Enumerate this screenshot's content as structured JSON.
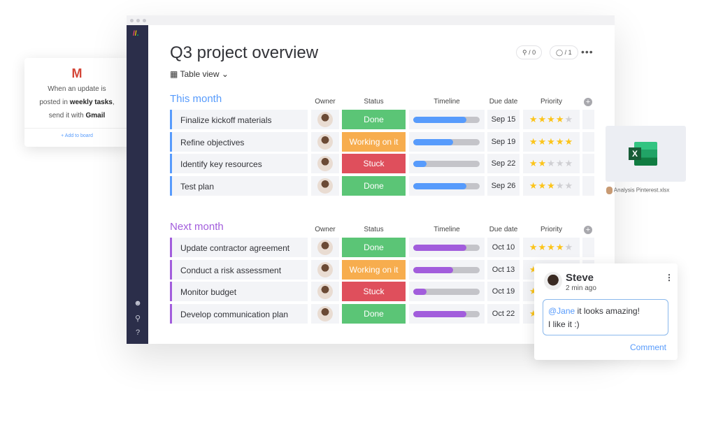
{
  "gmail_card": {
    "icon": "gmail-icon",
    "line1": "When an update is",
    "line2_pre": "posted in ",
    "line2_bold": "weekly tasks",
    "line2_post": ",",
    "line3_pre": "send it with ",
    "line3_bold": "Gmail",
    "add": "+ Add to board"
  },
  "board": {
    "title": "Q3 project overview",
    "view": "Table view",
    "activity_count": "/ 0",
    "integrations_count": "/ 1",
    "columns": {
      "owner": "Owner",
      "status": "Status",
      "timeline": "Timeline",
      "due": "Due date",
      "priority": "Priority"
    },
    "groups": [
      {
        "title": "This month",
        "color": "#579bfc",
        "items": [
          {
            "name": "Finalize kickoff materials",
            "status": "Done",
            "due": "Sep 15",
            "timeline_progress": 0.8,
            "priority": 4
          },
          {
            "name": "Refine objectives",
            "status": "Working on it",
            "due": "Sep 19",
            "timeline_progress": 0.6,
            "priority": 5
          },
          {
            "name": "Identify key resources",
            "status": "Stuck",
            "due": "Sep 22",
            "timeline_progress": 0.2,
            "priority": 2
          },
          {
            "name": "Test plan",
            "status": "Done",
            "due": "Sep 26",
            "timeline_progress": 0.8,
            "priority": 3
          }
        ]
      },
      {
        "title": "Next month",
        "color": "#a25ddc",
        "items": [
          {
            "name": "Update contractor agreement",
            "status": "Done",
            "due": "Oct 10",
            "timeline_progress": 0.8,
            "priority": 4
          },
          {
            "name": "Conduct a risk assessment",
            "status": "Working on it",
            "due": "Oct 13",
            "timeline_progress": 0.6,
            "priority": 4
          },
          {
            "name": "Monitor budget",
            "status": "Stuck",
            "due": "Oct 19",
            "timeline_progress": 0.2,
            "priority": 4
          },
          {
            "name": "Develop communication plan",
            "status": "Done",
            "due": "Oct 22",
            "timeline_progress": 0.8,
            "priority": 4
          }
        ]
      }
    ],
    "status_colors": {
      "Done": "#5bc576",
      "Working on it": "#f7ad4e",
      "Stuck": "#df4f5c"
    }
  },
  "file_card": {
    "icon": "excel-icon",
    "filename": "Analysis Pinterest.xlsx"
  },
  "comment": {
    "author": "Steve",
    "time": "2 min ago",
    "mention": "@Jane",
    "text1": " it looks amazing!",
    "text2": "I like it :)",
    "button": "Comment"
  }
}
